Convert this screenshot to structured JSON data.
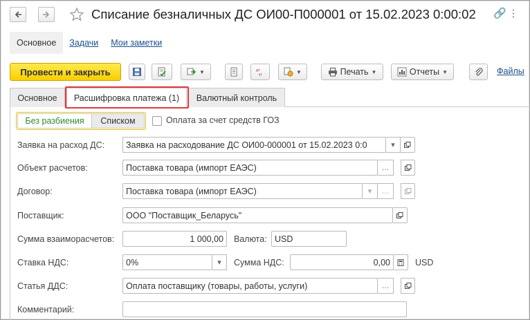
{
  "window": {
    "title": "Списание безналичных ДС ОИ00-П000001 от 15.02.2023 0:00:02"
  },
  "nav": {
    "tabs": [
      "Основное",
      "Задачи",
      "Мои заметки"
    ]
  },
  "toolbar": {
    "post_close": "Провести и закрыть",
    "print": "Печать",
    "reports": "Отчеты",
    "files": "Файлы"
  },
  "tabs": [
    "Основное",
    "Расшифровка платежа (1)",
    "Валютный контроль"
  ],
  "mode": {
    "no_split": "Без разбиения",
    "list": "Списком",
    "goz_label": "Оплата за счет средств ГОЗ",
    "goz_checked": false
  },
  "form": {
    "request_label": "Заявка на расход ДС:",
    "request_value": "Заявка на расходование ДС ОИ00-000001 от 15.02.2023 0:0",
    "object_label": "Объект расчетов:",
    "object_value": "Поставка товара (импорт ЕАЭС)",
    "contract_label": "Договор:",
    "contract_value": "Поставка товара (импорт ЕАЭС)",
    "supplier_label": "Поставщик:",
    "supplier_value": "ООО \"Поставщик_Беларусь\"",
    "amount_label": "Сумма взаиморасчетов:",
    "amount_value": "1 000,00",
    "currency_label": "Валюта:",
    "currency_value": "USD",
    "vat_rate_label": "Ставка НДС:",
    "vat_rate_value": "0%",
    "vat_sum_label": "Сумма НДС:",
    "vat_sum_value": "0,00",
    "vat_currency": "USD",
    "cashflow_label": "Статья ДДС:",
    "cashflow_value": "Оплата поставщику (товары, работы, услуги)",
    "comment_label": "Комментарий:",
    "comment_value": ""
  },
  "colors": {
    "primary_button": "#f7cf00",
    "link": "#1c4f8a",
    "highlight_box": "#e0393e",
    "active_mode": "#2e8b2e"
  }
}
